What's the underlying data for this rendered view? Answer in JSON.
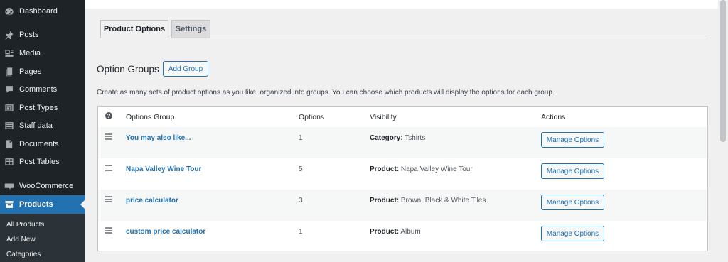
{
  "sidebar": {
    "items": [
      {
        "label": "Dashboard",
        "icon": "dashboard-icon"
      },
      {
        "label": "Posts",
        "icon": "pin-icon"
      },
      {
        "label": "Media",
        "icon": "media-icon"
      },
      {
        "label": "Pages",
        "icon": "pages-icon"
      },
      {
        "label": "Comments",
        "icon": "comment-icon"
      },
      {
        "label": "Post Types",
        "icon": "post-types-icon"
      },
      {
        "label": "Staff data",
        "icon": "list-icon"
      },
      {
        "label": "Documents",
        "icon": "document-icon"
      },
      {
        "label": "Post Tables",
        "icon": "table-icon"
      },
      {
        "label": "WooCommerce",
        "icon": "woocommerce-icon"
      },
      {
        "label": "Products",
        "icon": "archive-icon",
        "active": true
      }
    ],
    "submenu": [
      "All Products",
      "Add New",
      "Categories"
    ]
  },
  "tabs": [
    {
      "label": "Product Options",
      "active": true
    },
    {
      "label": "Settings",
      "active": false
    }
  ],
  "section": {
    "title": "Option Groups",
    "add_button": "Add Group",
    "description": "Create as many sets of product options as you like, organized into groups. You can choose which products will display the options for each group."
  },
  "table": {
    "help_glyph": "?",
    "headers": {
      "group": "Options Group",
      "options": "Options",
      "visibility": "Visibility",
      "actions": "Actions"
    },
    "rows": [
      {
        "name": "You may also like...",
        "options": "1",
        "vis_label": "Category:",
        "vis_value": "Tshirts",
        "action": "Manage Options"
      },
      {
        "name": "Napa Valley Wine Tour",
        "options": "5",
        "vis_label": "Product:",
        "vis_value": "Napa Valley Wine Tour",
        "action": "Manage Options"
      },
      {
        "name": "price calculator",
        "options": "3",
        "vis_label": "Product:",
        "vis_value": "Brown, Black & White Tiles",
        "action": "Manage Options"
      },
      {
        "name": "custom price calculator",
        "options": "1",
        "vis_label": "Product:",
        "vis_value": "Album",
        "action": "Manage Options"
      }
    ]
  },
  "colors": {
    "sidebar_bg": "#1d2327",
    "accent": "#2271b1",
    "page_bg": "#f0f0f1"
  }
}
